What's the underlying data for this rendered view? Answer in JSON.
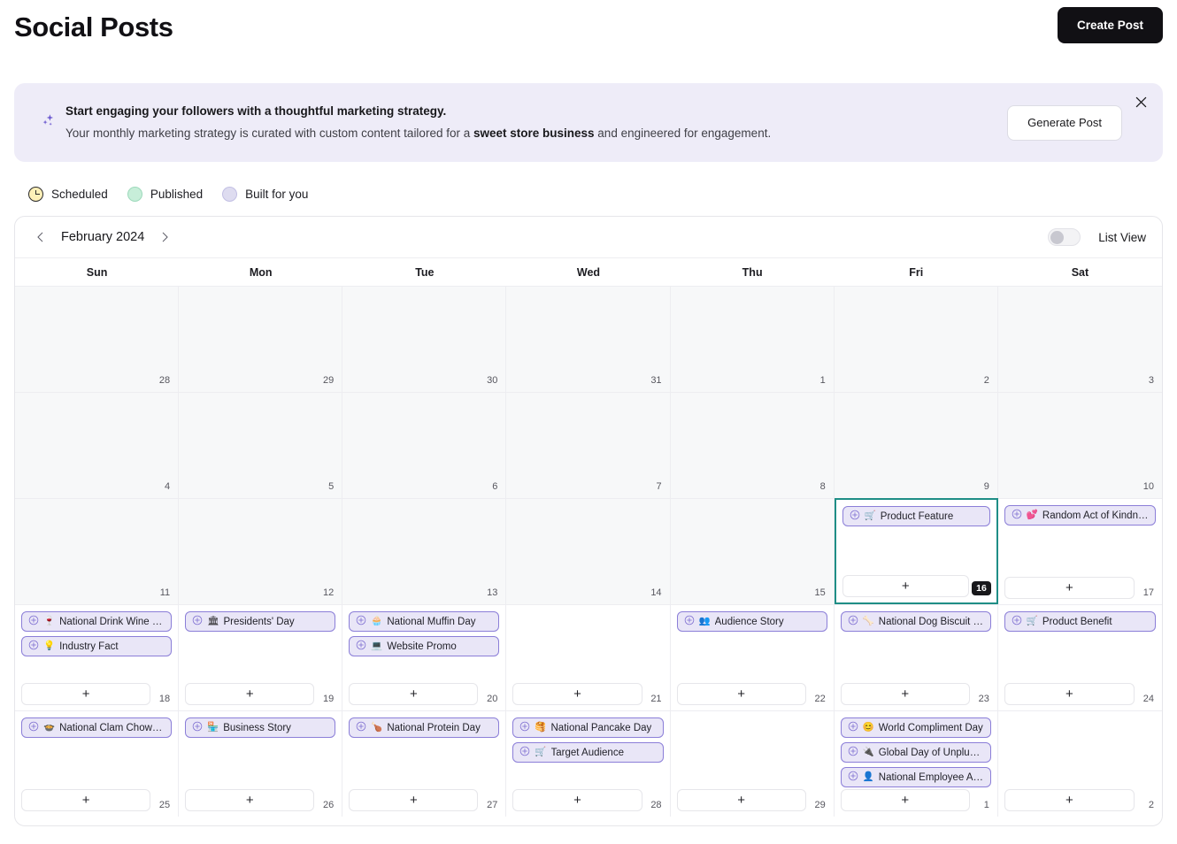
{
  "header": {
    "title": "Social Posts",
    "create_post_label": "Create Post"
  },
  "banner": {
    "icon": "sparkles-icon",
    "title": "Start engaging your followers with a thoughtful marketing strategy.",
    "subtitle_before": "Your monthly marketing strategy is curated with custom content tailored for a ",
    "subtitle_bold": "sweet store business",
    "subtitle_after": " and engineered for engagement.",
    "generate_post_label": "Generate Post",
    "close_icon": "close-icon",
    "background_color": "#eeecf8",
    "accent_color": "#6d5bd0"
  },
  "legend": {
    "items": [
      {
        "label": "Scheduled",
        "icon": "clock-icon",
        "color": "#fdf0b8"
      },
      {
        "label": "Published",
        "icon": "circle-icon",
        "color": "#c7eed9"
      },
      {
        "label": "Built for you",
        "icon": "circle-icon",
        "color": "#dedcf0"
      }
    ]
  },
  "calendar": {
    "month_label": "February 2024",
    "prev_icon": "chevron-left-icon",
    "next_icon": "chevron-right-icon",
    "list_view_label": "List View",
    "list_view_enabled": false,
    "today_date": "16",
    "today_border_color": "#1f8e86",
    "weekdays": [
      "Sun",
      "Mon",
      "Tue",
      "Wed",
      "Thu",
      "Fri",
      "Sat"
    ],
    "add_icon": "plus-icon",
    "chip_plus_icon": "circle-plus-icon",
    "chip_background": "#e9e6f7",
    "chip_border": "#8b7ed8",
    "cells": [
      {
        "day": "28",
        "muted": true,
        "today": false,
        "events": []
      },
      {
        "day": "29",
        "muted": true,
        "today": false,
        "events": []
      },
      {
        "day": "30",
        "muted": true,
        "today": false,
        "events": []
      },
      {
        "day": "31",
        "muted": true,
        "today": false,
        "events": []
      },
      {
        "day": "1",
        "muted": true,
        "today": false,
        "events": []
      },
      {
        "day": "2",
        "muted": true,
        "today": false,
        "events": []
      },
      {
        "day": "3",
        "muted": true,
        "today": false,
        "events": []
      },
      {
        "day": "4",
        "muted": true,
        "today": false,
        "events": []
      },
      {
        "day": "5",
        "muted": true,
        "today": false,
        "events": []
      },
      {
        "day": "6",
        "muted": true,
        "today": false,
        "events": []
      },
      {
        "day": "7",
        "muted": true,
        "today": false,
        "events": []
      },
      {
        "day": "8",
        "muted": true,
        "today": false,
        "events": []
      },
      {
        "day": "9",
        "muted": true,
        "today": false,
        "events": []
      },
      {
        "day": "10",
        "muted": true,
        "today": false,
        "events": []
      },
      {
        "day": "11",
        "muted": true,
        "today": false,
        "events": []
      },
      {
        "day": "12",
        "muted": true,
        "today": false,
        "events": []
      },
      {
        "day": "13",
        "muted": true,
        "today": false,
        "events": []
      },
      {
        "day": "14",
        "muted": true,
        "today": false,
        "events": []
      },
      {
        "day": "15",
        "muted": true,
        "today": false,
        "events": []
      },
      {
        "day": "16",
        "muted": false,
        "today": true,
        "has_add": true,
        "events": [
          {
            "emoji": "🛒",
            "label": "Product Feature"
          }
        ]
      },
      {
        "day": "17",
        "muted": false,
        "today": false,
        "has_add": true,
        "events": [
          {
            "emoji": "💕",
            "label": "Random Act of Kindness ..."
          }
        ]
      },
      {
        "day": "18",
        "muted": false,
        "today": false,
        "has_add": true,
        "events": [
          {
            "emoji": "🍷",
            "label": "National Drink Wine Day"
          },
          {
            "emoji": "💡",
            "label": "Industry Fact"
          }
        ]
      },
      {
        "day": "19",
        "muted": false,
        "today": false,
        "has_add": true,
        "events": [
          {
            "emoji": "🏛",
            "label": "Presidents' Day"
          }
        ]
      },
      {
        "day": "20",
        "muted": false,
        "today": false,
        "has_add": true,
        "events": [
          {
            "emoji": "🧁",
            "label": "National Muffin Day"
          },
          {
            "emoji": "💻",
            "label": "Website Promo"
          }
        ]
      },
      {
        "day": "21",
        "muted": false,
        "today": false,
        "has_add": true,
        "events": []
      },
      {
        "day": "22",
        "muted": false,
        "today": false,
        "has_add": true,
        "events": [
          {
            "emoji": "👥",
            "label": "Audience Story"
          }
        ]
      },
      {
        "day": "23",
        "muted": false,
        "today": false,
        "has_add": true,
        "events": [
          {
            "emoji": "🦴",
            "label": "National Dog Biscuit Day"
          }
        ]
      },
      {
        "day": "24",
        "muted": false,
        "today": false,
        "has_add": true,
        "events": [
          {
            "emoji": "🛒",
            "label": "Product Benefit"
          }
        ]
      },
      {
        "day": "25",
        "muted": false,
        "today": false,
        "has_add": true,
        "events": [
          {
            "emoji": "🍲",
            "label": "National Clam Chowder ..."
          }
        ]
      },
      {
        "day": "26",
        "muted": false,
        "today": false,
        "has_add": true,
        "events": [
          {
            "emoji": "🏪",
            "label": "Business Story"
          }
        ]
      },
      {
        "day": "27",
        "muted": false,
        "today": false,
        "has_add": true,
        "events": [
          {
            "emoji": "🍗",
            "label": "National Protein Day"
          }
        ]
      },
      {
        "day": "28",
        "muted": false,
        "today": false,
        "has_add": true,
        "events": [
          {
            "emoji": "🥞",
            "label": "National Pancake Day"
          },
          {
            "emoji": "🛒",
            "label": "Target Audience"
          }
        ]
      },
      {
        "day": "29",
        "muted": false,
        "today": false,
        "has_add": true,
        "events": []
      },
      {
        "day": "1",
        "muted": false,
        "today": false,
        "has_add": true,
        "events": [
          {
            "emoji": "😊",
            "label": "World Compliment Day"
          },
          {
            "emoji": "🔌",
            "label": "Global Day of Unplugging"
          },
          {
            "emoji": "👤",
            "label": "National Employee Appr..."
          }
        ]
      },
      {
        "day": "2",
        "muted": false,
        "today": false,
        "has_add": true,
        "events": []
      }
    ]
  }
}
